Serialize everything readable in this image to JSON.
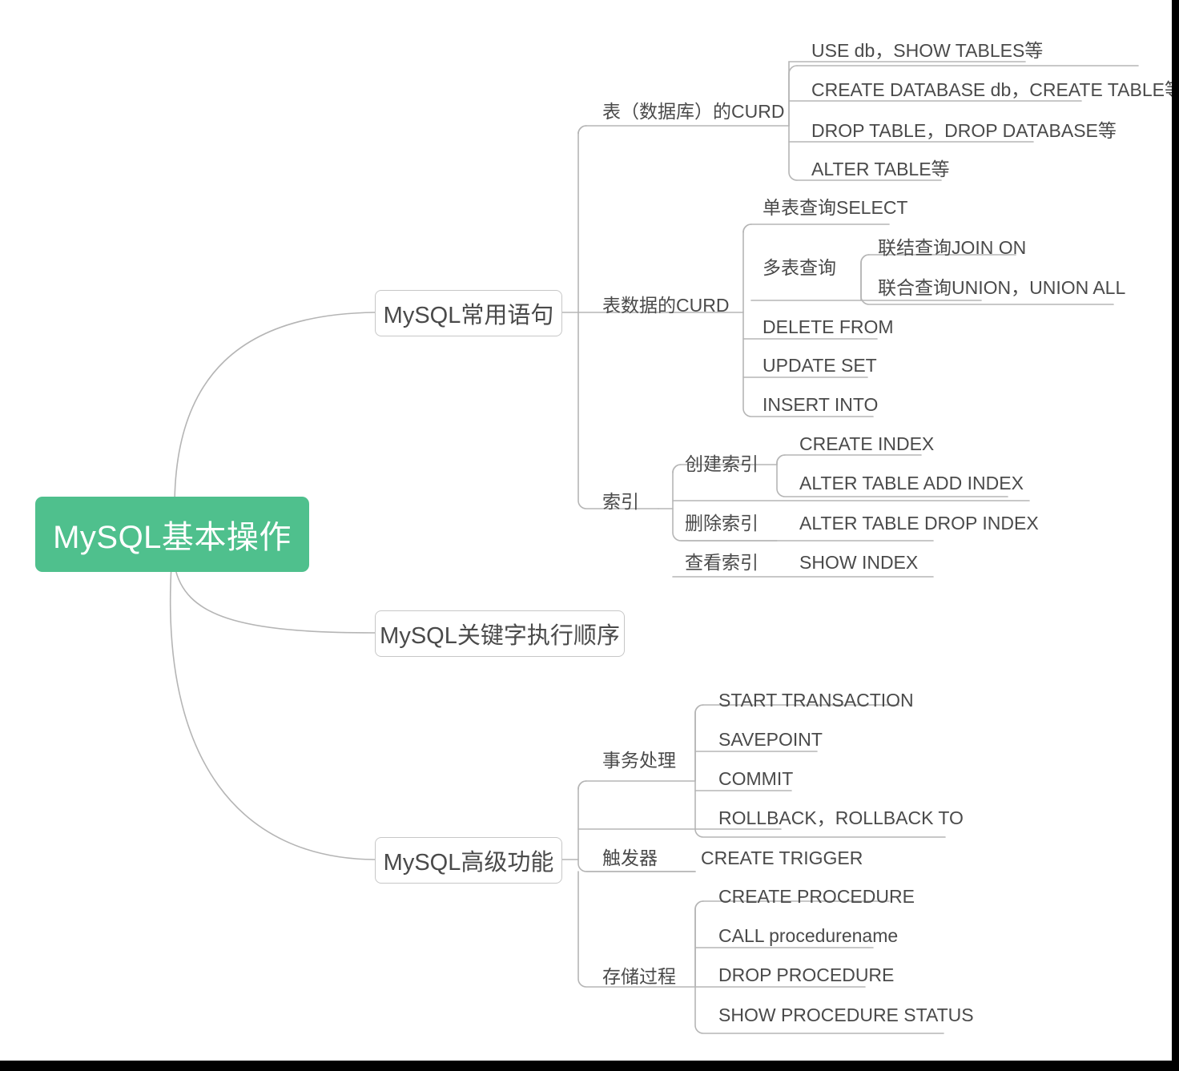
{
  "diagram": {
    "type": "mindmap",
    "title": "MySQL基本操作",
    "root": {
      "label": "MySQL基本操作",
      "color": "#4fc08d",
      "text_color": "#ffffff"
    },
    "line_color": "#b5b5b5",
    "text_color": "#4a4a4a",
    "branches": [
      {
        "label": "MySQL常用语句",
        "children": [
          {
            "label": "表（数据库）的CURD",
            "children": [
              {
                "label": "USE db，SHOW TABLES等"
              },
              {
                "label": "CREATE DATABASE db，CREATE TABLE等"
              },
              {
                "label": "DROP TABLE，DROP DATABASE等"
              },
              {
                "label": "ALTER TABLE等"
              }
            ]
          },
          {
            "label": "表数据的CURD",
            "children": [
              {
                "label": "单表查询SELECT"
              },
              {
                "label": "多表查询",
                "children": [
                  {
                    "label": "联结查询JOIN ON"
                  },
                  {
                    "label": "联合查询UNION，UNION ALL"
                  }
                ]
              },
              {
                "label": "DELETE FROM"
              },
              {
                "label": "UPDATE SET"
              },
              {
                "label": "INSERT INTO"
              }
            ]
          },
          {
            "label": "索引",
            "children": [
              {
                "label": "创建索引",
                "children": [
                  {
                    "label": "CREATE INDEX"
                  },
                  {
                    "label": "ALTER TABLE ADD INDEX"
                  }
                ]
              },
              {
                "label": "删除索引",
                "children": [
                  {
                    "label": "ALTER TABLE DROP INDEX"
                  }
                ]
              },
              {
                "label": "查看索引",
                "children": [
                  {
                    "label": "SHOW INDEX"
                  }
                ]
              }
            ]
          }
        ]
      },
      {
        "label": "MySQL关键字执行顺序",
        "children": []
      },
      {
        "label": "MySQL高级功能",
        "children": [
          {
            "label": "事务处理",
            "children": [
              {
                "label": "START TRANSACTION"
              },
              {
                "label": "SAVEPOINT"
              },
              {
                "label": "COMMIT"
              },
              {
                "label": "ROLLBACK，ROLLBACK TO"
              }
            ]
          },
          {
            "label": "触发器",
            "children": [
              {
                "label": "CREATE TRIGGER"
              }
            ]
          },
          {
            "label": "存储过程",
            "children": [
              {
                "label": "CREATE PROCEDURE"
              },
              {
                "label": "CALL procedurename"
              },
              {
                "label": "DROP PROCEDURE"
              },
              {
                "label": "SHOW PROCEDURE STATUS"
              }
            ]
          }
        ]
      }
    ]
  },
  "labels": {
    "root": "MySQL基本操作",
    "b1": "MySQL常用语句",
    "b2": "MySQL关键字执行顺序",
    "b3": "MySQL高级功能",
    "b1c1": "表（数据库）的CURD",
    "b1c1g1": "USE db，SHOW TABLES等",
    "b1c1g2": "CREATE DATABASE db，CREATE TABLE等",
    "b1c1g3": "DROP TABLE，DROP DATABASE等",
    "b1c1g4": "ALTER TABLE等",
    "b1c2": "表数据的CURD",
    "b1c2g1": "单表查询SELECT",
    "b1c2g2": "多表查询",
    "b1c2g2h1": "联结查询JOIN ON",
    "b1c2g2h2": "联合查询UNION，UNION ALL",
    "b1c2g3": "DELETE FROM",
    "b1c2g4": "UPDATE SET",
    "b1c2g5": "INSERT INTO",
    "b1c3": "索引",
    "b1c3g1": "创建索引",
    "b1c3g1h1": "CREATE INDEX",
    "b1c3g1h2": "ALTER TABLE ADD INDEX",
    "b1c3g2": "删除索引",
    "b1c3g2h1": "ALTER TABLE DROP INDEX",
    "b1c3g3": "查看索引",
    "b1c3g3h1": "SHOW INDEX",
    "b3c1": "事务处理",
    "b3c1g1": "START TRANSACTION",
    "b3c1g2": "SAVEPOINT",
    "b3c1g3": "COMMIT",
    "b3c1g4": "ROLLBACK，ROLLBACK TO",
    "b3c2": "触发器",
    "b3c2g1": "CREATE TRIGGER",
    "b3c3": "存储过程",
    "b3c3g1": "CREATE PROCEDURE",
    "b3c3g2": "CALL procedurename",
    "b3c3g3": "DROP PROCEDURE",
    "b3c3g4": "SHOW PROCEDURE STATUS"
  }
}
